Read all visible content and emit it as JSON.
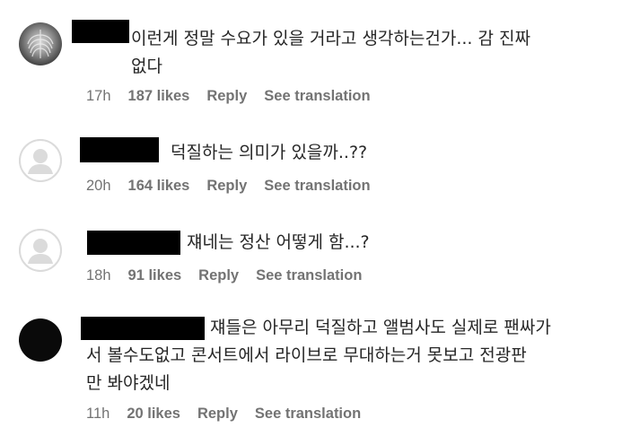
{
  "comments": [
    {
      "avatar_style": "photo",
      "text": "이런게 정말 수요가 있을 거라고 생각하는건가... 감 진짜\n없다",
      "time": "17h",
      "likes": "187 likes",
      "reply": "Reply",
      "translate": "See translation"
    },
    {
      "avatar_style": "default",
      "text": "덕질하는 의미가 있을까..??",
      "time": "20h",
      "likes": "164 likes",
      "reply": "Reply",
      "translate": "See translation"
    },
    {
      "avatar_style": "default",
      "text": "쟤네는 정산 어떻게 함...?",
      "time": "18h",
      "likes": "91 likes",
      "reply": "Reply",
      "translate": "See translation"
    },
    {
      "avatar_style": "black",
      "text": "쟤들은 아무리 덕질하고 앨범사도 실제로 팬싸가\n서 볼수도없고 콘서트에서 라이브로 무대하는거 못보고 전광판\n만 봐야겠네",
      "time": "11h",
      "likes": "20 likes",
      "reply": "Reply",
      "translate": "See translation"
    }
  ]
}
